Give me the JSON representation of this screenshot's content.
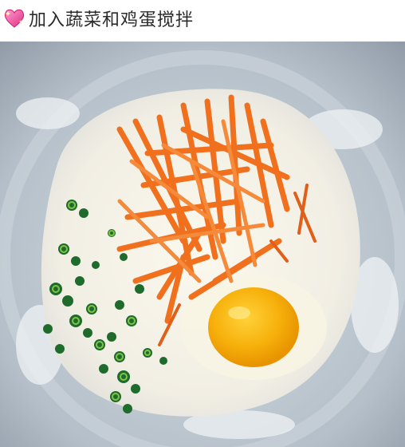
{
  "caption": {
    "text": "加入蔬菜和鸡蛋搅拌",
    "icon": "sparkling-heart-icon"
  },
  "photo": {
    "subject": "bowl-with-batter-carrot-scallion-egg",
    "colors": {
      "bowl": "#aeb9c4",
      "batter": "#f4f1e8",
      "carrot": "#f0701e",
      "scallion": "#1f6b2c",
      "yolk": "#f6b20f"
    }
  }
}
